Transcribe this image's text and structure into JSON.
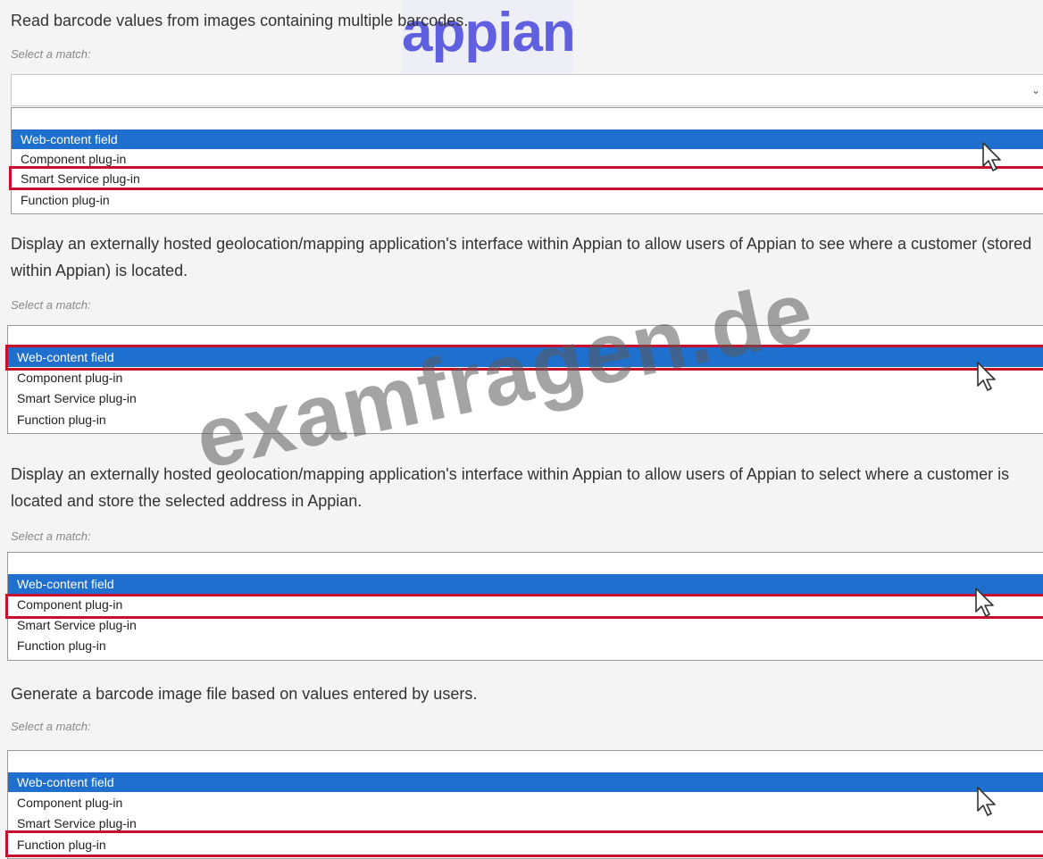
{
  "logo": {
    "text": "appian"
  },
  "watermark": {
    "text": "examfragen.de"
  },
  "questions": [
    {
      "text": "Read barcode values from images containing multiple barcodes.",
      "label": "Select a match:",
      "options": [
        "Web-content field",
        "Component plug-in",
        "Smart Service plug-in",
        "Function plug-in"
      ],
      "selected": "Web-content field",
      "highlighted": "Smart Service plug-in"
    },
    {
      "text": "Display an externally hosted geolocation/mapping application's interface within Appian to allow users of Appian to see where a customer (stored within Appian) is located.",
      "label": "Select a match:",
      "options": [
        "Web-content field",
        "Component plug-in",
        "Smart Service plug-in",
        "Function plug-in"
      ],
      "selected": "Web-content field",
      "highlighted": "Web-content field"
    },
    {
      "text": "Display an externally hosted geolocation/mapping application's interface within Appian to allow users of Appian to select where a customer is located and store the selected address in Appian.",
      "label": "Select a match:",
      "options": [
        "Web-content field",
        "Component plug-in",
        "Smart Service plug-in",
        "Function plug-in"
      ],
      "selected": "Web-content field",
      "highlighted": "Component plug-in"
    },
    {
      "text": "Generate a barcode image file based on values entered by users.",
      "label": "Select a match:",
      "options": [
        "Web-content field",
        "Component plug-in",
        "Smart Service plug-in",
        "Function plug-in"
      ],
      "selected": "Web-content field",
      "highlighted": "Function plug-in"
    }
  ],
  "colors": {
    "selection": "#1f6fce",
    "highlight_border": "#c8102e",
    "logo": "#5f5fe0"
  },
  "icons": [
    "chevron-down-icon",
    "mouse-pointer-icon"
  ]
}
